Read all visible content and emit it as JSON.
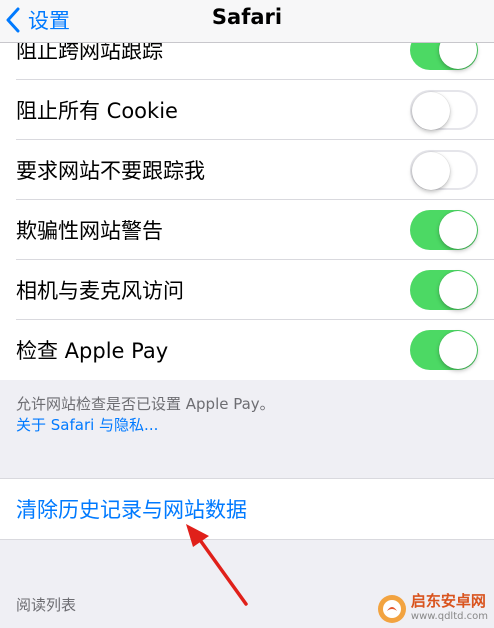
{
  "nav": {
    "back_label": "设置",
    "title": "Safari"
  },
  "privacy_group": [
    {
      "label": "阻止跨网站跟踪",
      "state": "on"
    },
    {
      "label": "阻止所有 Cookie",
      "state": "off"
    },
    {
      "label": "要求网站不要跟踪我",
      "state": "off"
    },
    {
      "label": "欺骗性网站警告",
      "state": "on"
    },
    {
      "label": "相机与麦克风访问",
      "state": "on"
    },
    {
      "label": "检查 Apple Pay",
      "state": "on"
    }
  ],
  "footer": {
    "note": "允许网站检查是否已设置 Apple Pay。",
    "link": "关于 Safari 与隐私..."
  },
  "clear_history": {
    "label": "清除历史记录与网站数据"
  },
  "reading_list": {
    "header": "阅读列表"
  },
  "watermark": {
    "name": "启东安卓网",
    "url": "www.qdltd.com"
  },
  "colors": {
    "accent": "#007aff",
    "switch_on": "#4cd964",
    "annotation_arrow": "#e0201a"
  },
  "icons": {
    "back": "chevron-left-icon",
    "watermark_logo": "qidong-logo-icon",
    "annotation": "red-arrow-icon"
  }
}
